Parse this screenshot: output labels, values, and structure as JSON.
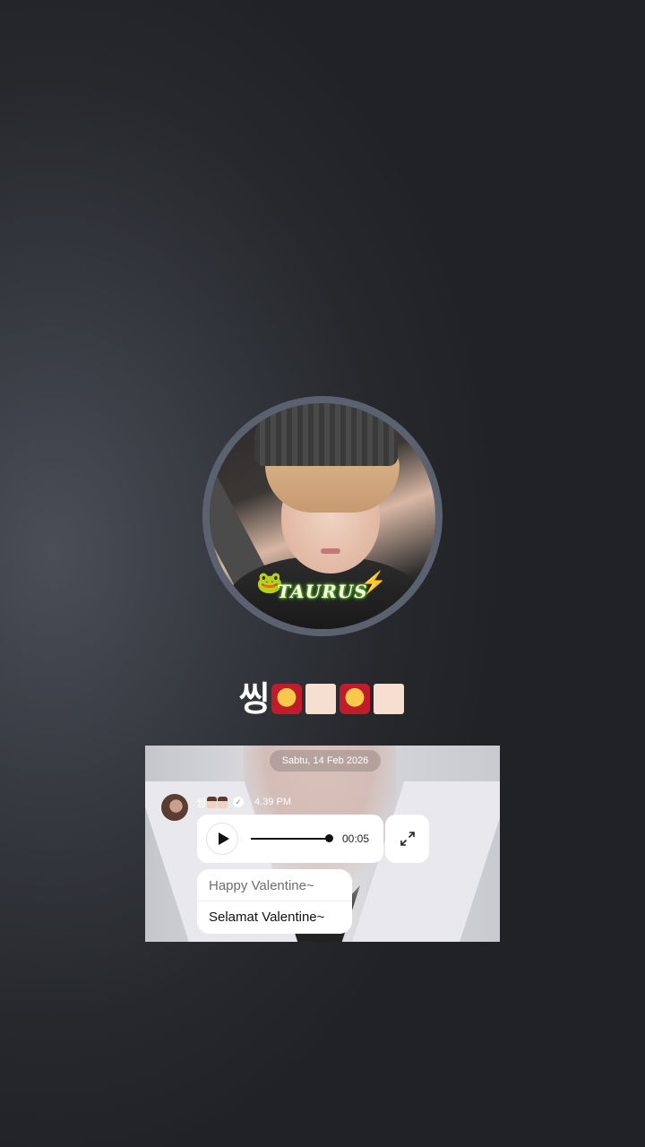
{
  "profile": {
    "avatar_overlay_text": "TAURUS",
    "display_name": "씽"
  },
  "preview": {
    "date_label": "Sabtu, 14 Feb 2026",
    "sender_name": "씽",
    "time": "4.39 PM",
    "audio": {
      "duration": "00:05",
      "progress": 1.0
    },
    "caption_original": "Happy Valentine~",
    "caption_translated": "Selamat Valentine~"
  },
  "icons": {
    "play": "play-icon",
    "expand": "expand-icon",
    "verified": "verified-badge-icon"
  },
  "colors": {
    "background": "#2b2d31",
    "avatar_ring": "#5c6170",
    "bubble": "#ffffff"
  }
}
